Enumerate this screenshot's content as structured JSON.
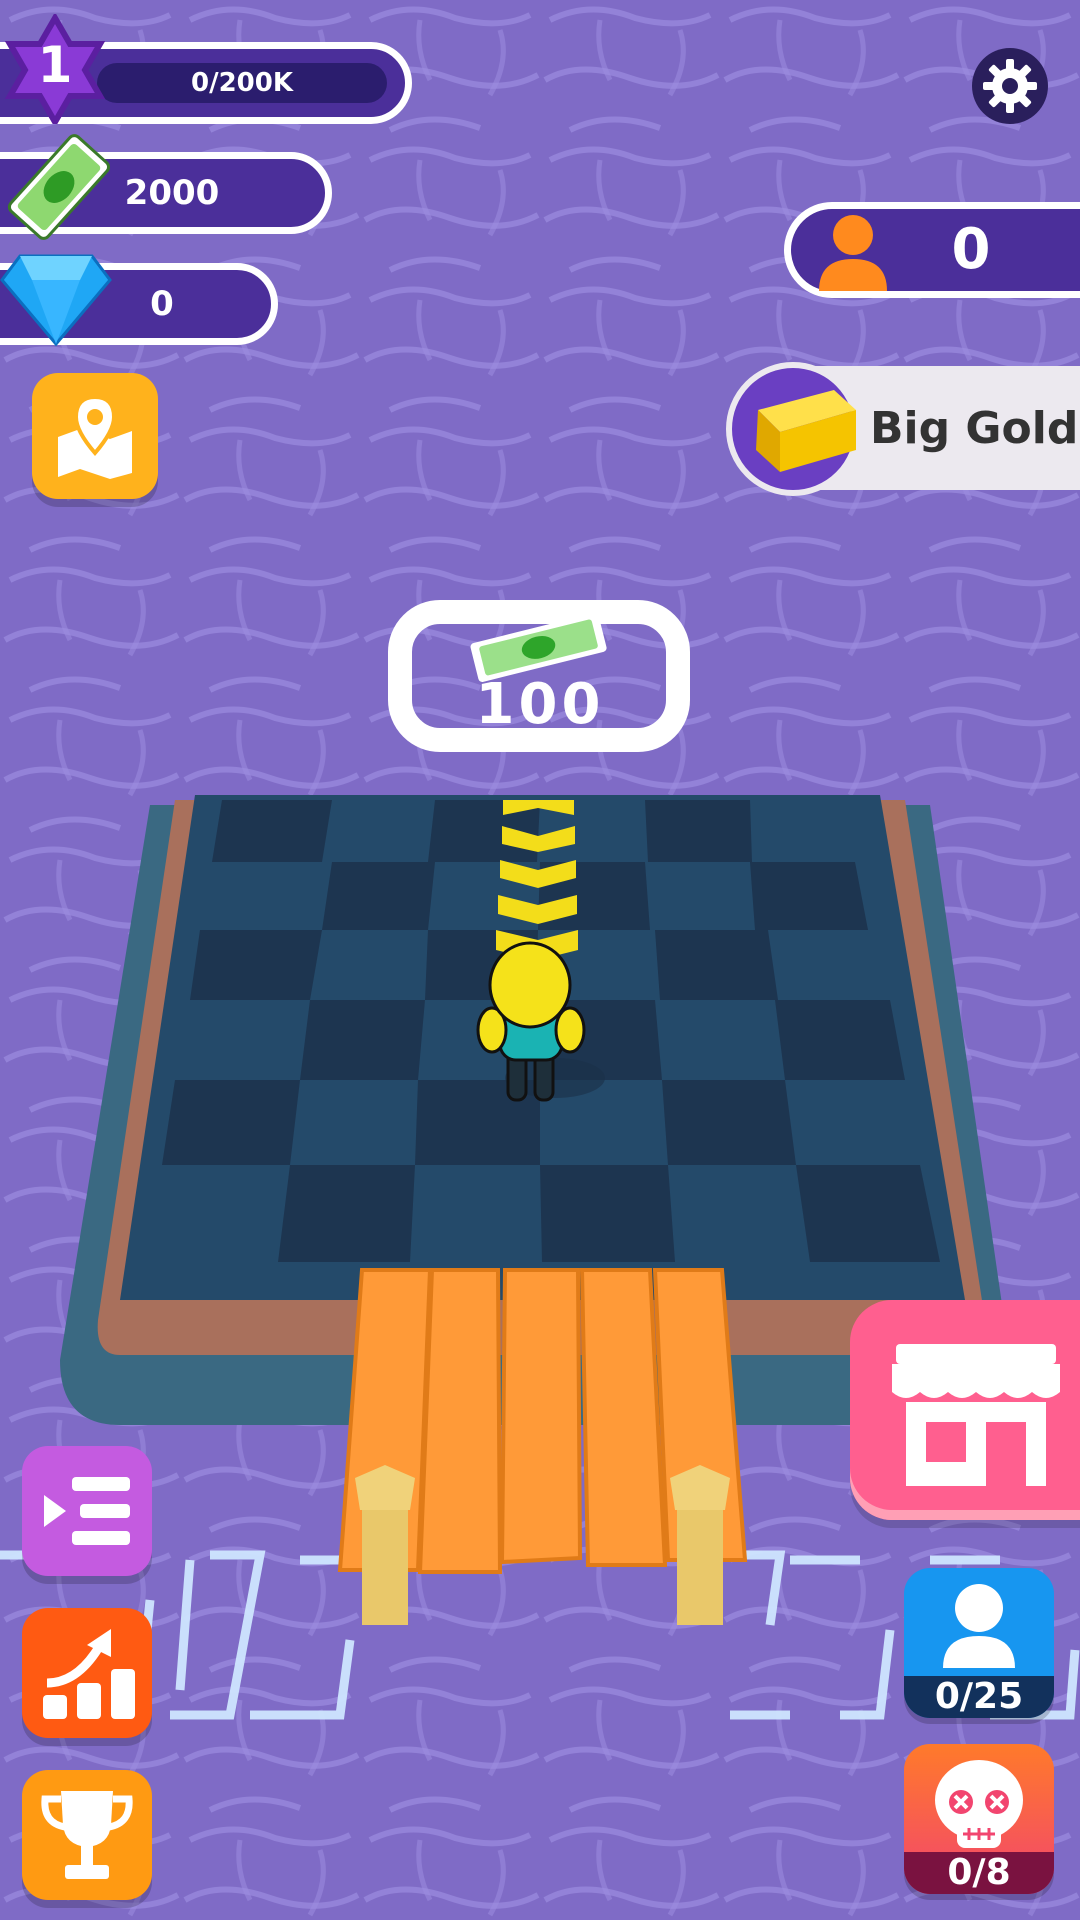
{
  "hud": {
    "level": "1",
    "xp_progress_text": "0/200K",
    "cash_amount": "2000",
    "gems_amount": "0",
    "population_count": "0",
    "bonus_label": "Big Gold"
  },
  "world": {
    "price_pad_value": "100"
  },
  "side_buttons": {
    "workers_count": "0/25",
    "enemies_count": "0/8"
  },
  "icons": {
    "level": "star-badge-icon",
    "cash": "money-bill-icon",
    "gems": "diamond-icon",
    "settings": "gear-icon",
    "population": "person-icon",
    "bonus": "gold-bar-icon",
    "map": "map-pin-icon",
    "menu": "list-menu-icon",
    "upgrade": "upgrade-chart-icon",
    "trophy": "trophy-icon",
    "shop": "shop-storefront-icon",
    "workers": "user-icon",
    "enemies": "skull-icon"
  },
  "colors": {
    "water": "#7f6bc6",
    "hud_pill": "#4b2f9a",
    "map_button": "#ffb21c",
    "menu_button": "#c45be0",
    "upgrade_button": "#ff5a12",
    "trophy_button": "#ff9a12",
    "shop_button": "#ff5f8f",
    "workers_button": "#1796f0",
    "enemies_button": "#f2456f"
  }
}
